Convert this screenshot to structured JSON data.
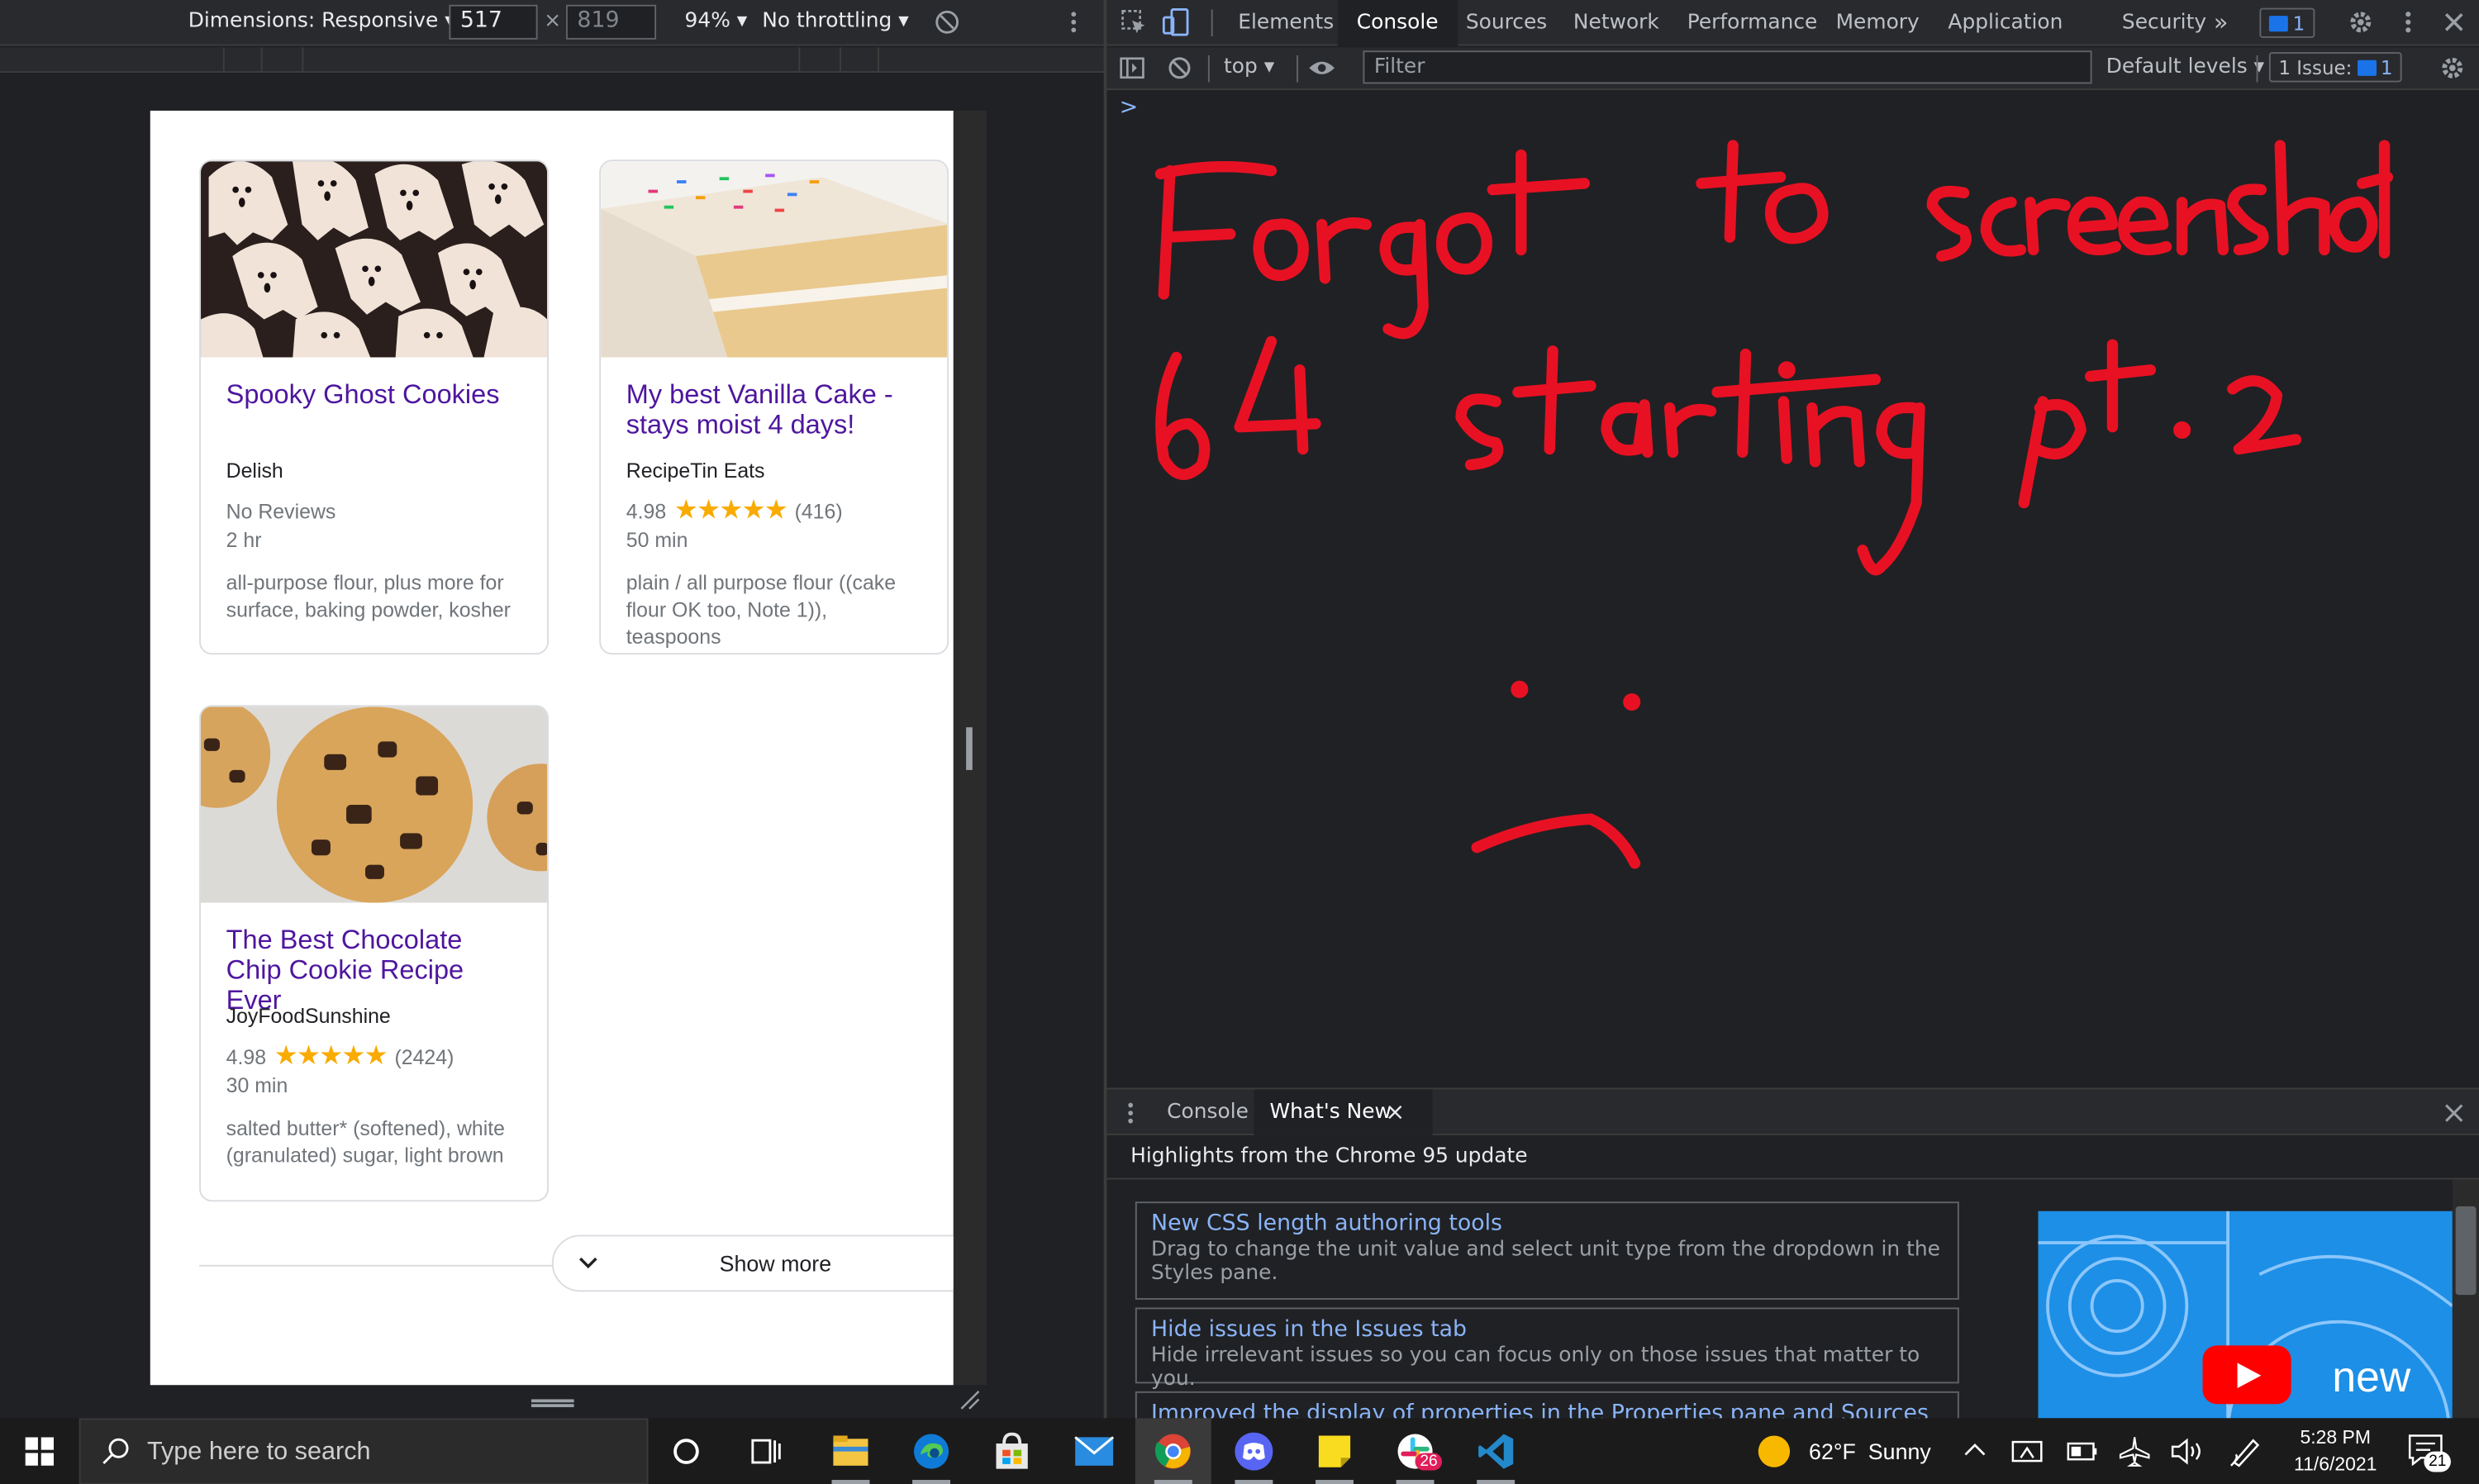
{
  "device_toolbar": {
    "dimensions_label": "Dimensions: Responsive",
    "width_value": "517",
    "times": "×",
    "height_placeholder": "819",
    "zoom": "94%",
    "throttling": "No throttling"
  },
  "recipe_cards": [
    {
      "title": "Spooky Ghost Cookies",
      "source": "Delish",
      "rating_text": "No Reviews",
      "time": "2 hr",
      "ingredients": "all-purpose flour, plus more for surface, baking powder, kosher"
    },
    {
      "title": "My best Vanilla Cake - stays moist 4 days!",
      "source": "RecipeTin Eats",
      "rating": "4.98",
      "stars": "★★★★★",
      "count": "(416)",
      "time": "50 min",
      "ingredients": "plain / all purpose flour ((cake flour OK too, Note 1)), teaspoons"
    },
    {
      "title": "The Best Chocolate Chip Cookie Recipe Ever",
      "source": "JoyFoodSunshine",
      "rating": "4.98",
      "stars": "★★★★★",
      "count": "(2424)",
      "time": "30 min",
      "ingredients": "salted butter* (softened), white (granulated) sugar, light brown"
    }
  ],
  "show_more_label": "Show more",
  "devtools": {
    "tabs": [
      "Elements",
      "Console",
      "Sources",
      "Network",
      "Performance",
      "Memory",
      "Application",
      "Security"
    ],
    "active_tab": "Console",
    "more_tabs": "»",
    "messages_badge": "1",
    "context": "top",
    "filter_placeholder": "Filter",
    "levels": "Default levels",
    "issues_label": "1 Issue:",
    "issues_count": "1",
    "prompt": ">",
    "drawer_tabs": [
      "Console",
      "What's New"
    ],
    "drawer_close": "×",
    "highlights": "Highlights from the Chrome 95 update",
    "news": [
      {
        "title": "New CSS length authoring tools",
        "desc": "Drag to change the unit value and select unit type from the dropdown in the Styles pane."
      },
      {
        "title": "Hide issues in the Issues tab",
        "desc": "Hide irrelevant issues so you can focus only on those issues that matter to you."
      },
      {
        "title": "Improved the display of properties in the Properties pane and Sources panel",
        "desc": ""
      }
    ],
    "video_label": "new"
  },
  "taskbar": {
    "search_placeholder": "Type here to search",
    "weather": "62°F  Sunny",
    "time": "5:28 PM",
    "date": "11/6/2021",
    "notifications": "21",
    "slack_badge": "26"
  },
  "handwriting": "Forgot to screenshot 64 starting pt. 2 :("
}
